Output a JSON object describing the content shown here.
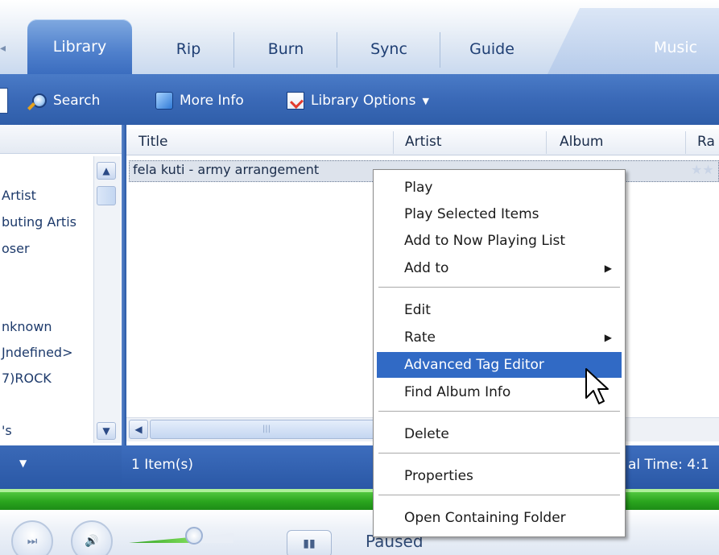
{
  "tabs": {
    "library": "Library",
    "rip": "Rip",
    "burn": "Burn",
    "sync": "Sync",
    "guide": "Guide",
    "music": "Music"
  },
  "toolbar": {
    "search": "Search",
    "more_info": "More Info",
    "library_options": "Library Options"
  },
  "nav": {
    "items": [
      "Artist",
      "buting Artis",
      "oser",
      "nknown",
      "Jndefined>",
      "7)ROCK",
      "'s"
    ]
  },
  "list": {
    "columns": {
      "title": "Title",
      "artist": "Artist",
      "album": "Album",
      "rating": "Ra"
    },
    "rows": [
      {
        "title": "fela kuti - army arrangement"
      }
    ]
  },
  "status": {
    "items": "1 Item(s)",
    "total_time": "al Time: 4:1"
  },
  "transport": {
    "state": "Paused"
  },
  "context_menu": {
    "items": [
      {
        "label": "Play"
      },
      {
        "label": "Play Selected Items"
      },
      {
        "label": "Add to Now Playing List"
      },
      {
        "label": "Add to"
      },
      {
        "label": "Edit"
      },
      {
        "label": "Rate"
      },
      {
        "label": "Advanced Tag Editor"
      },
      {
        "label": "Find Album Info"
      },
      {
        "label": "Delete"
      },
      {
        "label": "Properties"
      },
      {
        "label": "Open Containing Folder"
      }
    ],
    "highlighted": "Advanced Tag Editor"
  },
  "colors": {
    "accent": "#316ac5",
    "toolbar_blue": "#3a69b7",
    "seek_green": "#2aa51e"
  }
}
